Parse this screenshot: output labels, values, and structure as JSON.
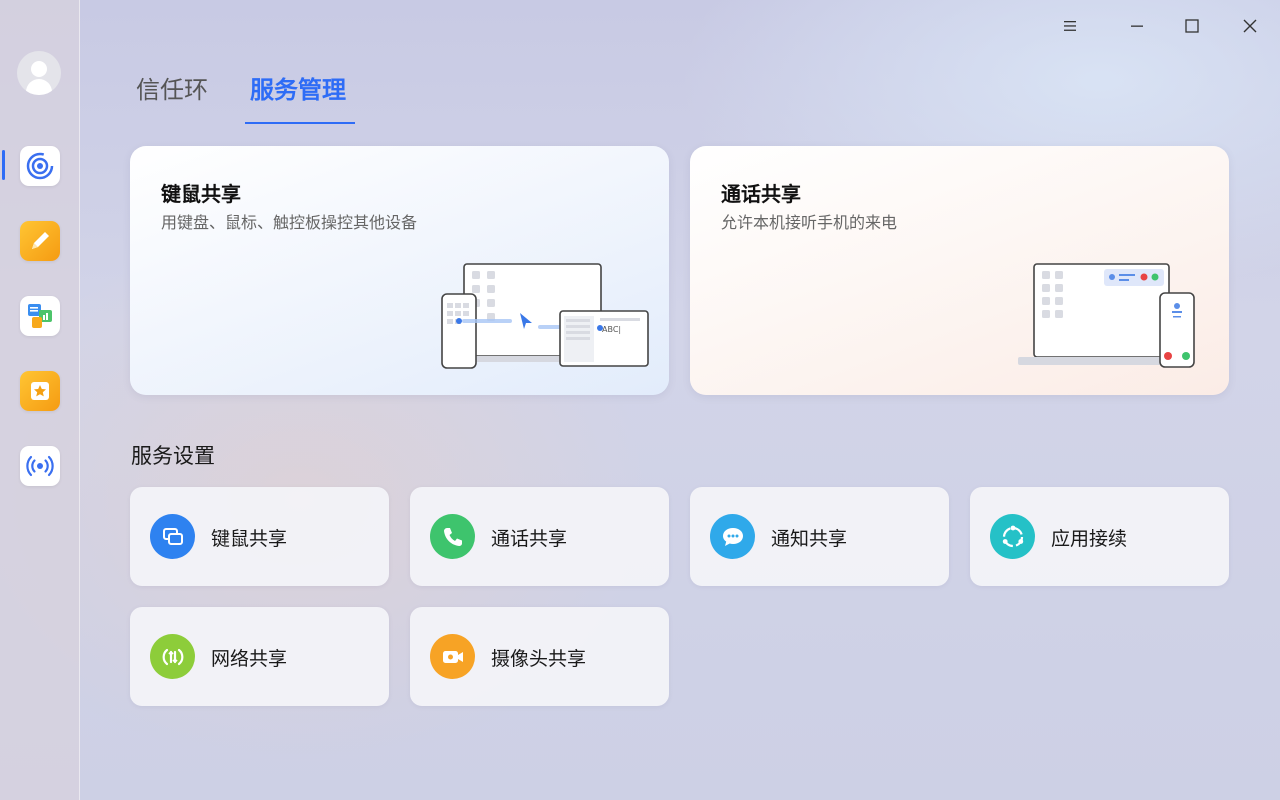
{
  "window": {
    "controls": {
      "menu": "menu-icon",
      "minimize": "minimize-icon",
      "maximize": "maximize-icon",
      "close": "close-icon"
    }
  },
  "sidebar": {
    "avatar": "avatar-icon",
    "apps": [
      {
        "name": "trust-ring-app",
        "icon": "target-icon",
        "color": "#3a6ff0"
      },
      {
        "name": "notes-app",
        "icon": "pencil-icon",
        "color": "#f7a91c"
      },
      {
        "name": "docs-app",
        "icon": "document-icon",
        "color": "#3a9cf0"
      },
      {
        "name": "favorites-app",
        "icon": "star-icon",
        "color": "#f7a91c"
      },
      {
        "name": "connect-app",
        "icon": "broadcast-icon",
        "color": "#3a6ff0"
      }
    ]
  },
  "tabs": [
    {
      "label": "信任环",
      "active": false
    },
    {
      "label": "服务管理",
      "active": true
    }
  ],
  "cards": [
    {
      "title": "键鼠共享",
      "description": "用键盘、鼠标、触控板操控其他设备"
    },
    {
      "title": "通话共享",
      "description": "允许本机接听手机的来电"
    }
  ],
  "section": {
    "title": "服务设置"
  },
  "services": [
    {
      "label": "键鼠共享",
      "icon": "kvm-icon",
      "color": "#2e82f0"
    },
    {
      "label": "通话共享",
      "icon": "phone-icon",
      "color": "#3ec46d"
    },
    {
      "label": "通知共享",
      "icon": "chat-icon",
      "color": "#2fa9ea"
    },
    {
      "label": "应用接续",
      "icon": "sync-icon",
      "color": "#25c1c7"
    },
    {
      "label": "网络共享",
      "icon": "network-icon",
      "color": "#8dcd3a"
    },
    {
      "label": "摄像头共享",
      "icon": "camera-icon",
      "color": "#f7a325"
    }
  ],
  "illustration_text": {
    "abc": "ABC|"
  }
}
